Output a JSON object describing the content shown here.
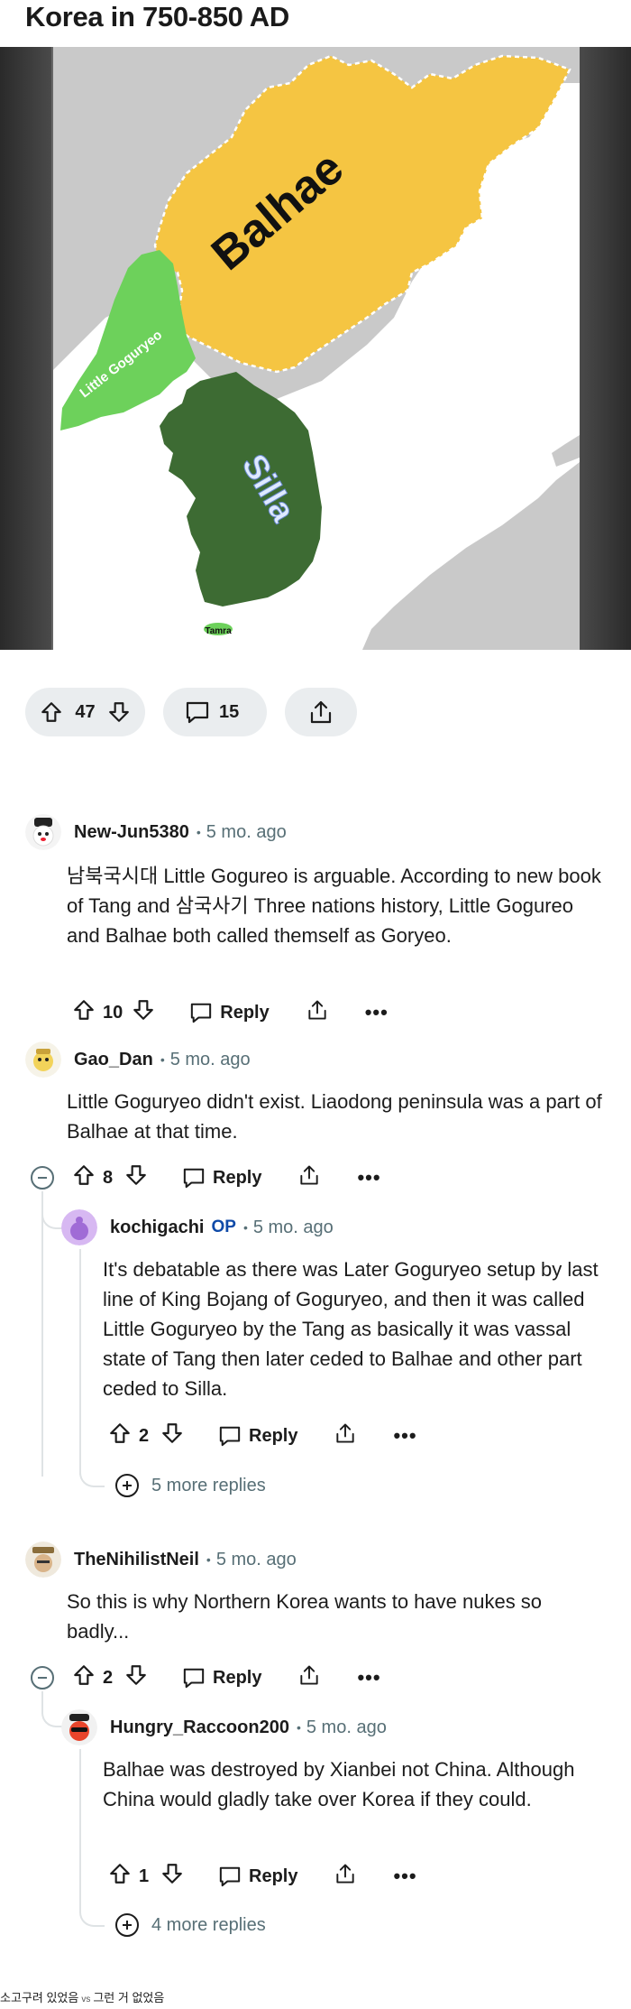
{
  "post": {
    "title": "Korea in 750-850 AD",
    "map_labels": {
      "balhae": "Balhae",
      "little_goguryeo": "Little Goguryeo",
      "silla": "Silla",
      "tamra": "Tamra"
    },
    "vote_count": "47",
    "comment_count": "15"
  },
  "comments": [
    {
      "username": "New-Jun5380",
      "op": "",
      "time": "5 mo. ago",
      "body": "남북국시대 Little Gogureo is arguable. According to new book of Tang and 삼국사기 Three nations history, Little Gogureo and Balhae both called themself as Goryeo.",
      "votes": "10",
      "reply_label": "Reply"
    },
    {
      "username": "Gao_Dan",
      "op": "",
      "time": "5 mo. ago",
      "body": "Little Goguryeo didn't exist. Liaodong peninsula was a part of Balhae at that time.",
      "votes": "8",
      "reply_label": "Reply"
    },
    {
      "username": "kochigachi",
      "op": "OP",
      "time": "5 mo. ago",
      "body": "It's debatable as there was Later Goguryeo setup by last line of King Bojang of Goguryeo, and then it was called Little Goguryeo by the Tang as basically it was vassal state of Tang then later ceded to Balhae and other part ceded to Silla.",
      "votes": "2",
      "reply_label": "Reply",
      "more_replies": "5 more replies"
    },
    {
      "username": "TheNihilistNeil",
      "op": "",
      "time": "5 mo. ago",
      "body": "So this is why Northern Korea wants to have nukes so badly...",
      "votes": "2",
      "reply_label": "Reply"
    },
    {
      "username": "Hungry_Raccoon200",
      "op": "",
      "time": "5 mo. ago",
      "body": "Balhae was destroyed by Xianbei not China. Although China would gladly take over Korea if they could.",
      "votes": "1",
      "reply_label": "Reply",
      "more_replies": "4 more replies"
    }
  ],
  "footer": {
    "left": "소고구려 있었음",
    "vs": "vs",
    "right": "그런 거 없었음"
  },
  "colors": {
    "balhae": "#f5c542",
    "little_goguryeo": "#6dd15b",
    "silla": "#3d6b33",
    "land_other": "#c9c9c9",
    "sea": "#ffffff",
    "pill_bg": "#eaedef",
    "op_blue": "#0f4aa8"
  }
}
